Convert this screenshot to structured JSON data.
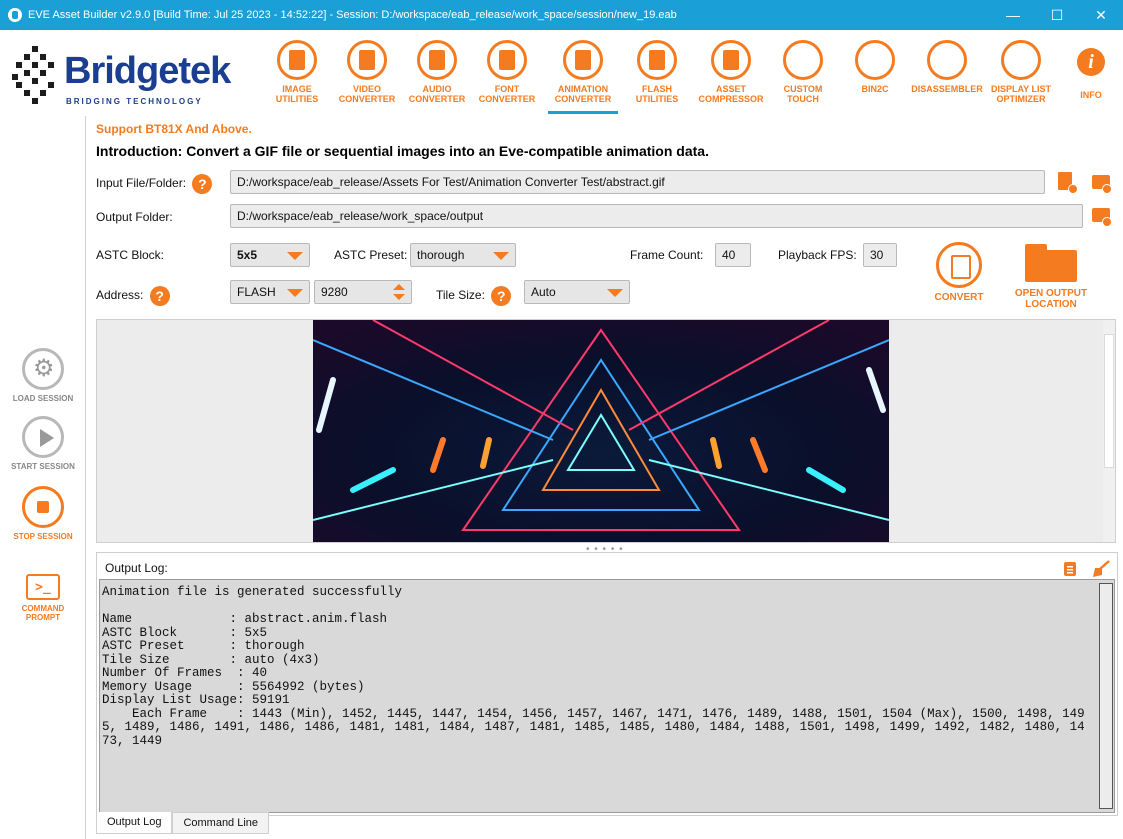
{
  "window": {
    "title": "EVE Asset Builder v2.9.0 [Build Time: Jul 25 2023 - 14:52:22] - Session: D:/workspace/eab_release/work_space/session/new_19.eab",
    "minimize": "—",
    "maximize": "☐",
    "close": "✕"
  },
  "logo": {
    "word": "Bridgetek",
    "tagline": "BRIDGING  TECHNOLOGY"
  },
  "toolbar": [
    {
      "label": "IMAGE\nUTILITIES",
      "icon": "image-icon"
    },
    {
      "label": "VIDEO\nCONVERTER",
      "icon": "video-icon"
    },
    {
      "label": "AUDIO\nCONVERTER",
      "icon": "audio-icon"
    },
    {
      "label": "FONT\nCONVERTER",
      "icon": "font-icon"
    },
    {
      "label": "ANIMATION\nCONVERTER",
      "icon": "animation-icon",
      "active": true
    },
    {
      "label": "FLASH\nUTILITIES",
      "icon": "flash-icon"
    },
    {
      "label": "ASSET\nCOMPRESSOR",
      "icon": "compressor-icon"
    },
    {
      "label": "CUSTOM\nTOUCH",
      "icon": "touch-icon"
    },
    {
      "label": "BIN2C",
      "icon": "binary-icon"
    },
    {
      "label": "DISASSEMBLER",
      "icon": "disassembler-icon"
    },
    {
      "label": "DISPLAY LIST\nOPTIMIZER",
      "icon": "display-list-icon"
    },
    {
      "label": "INFO",
      "icon": "info-icon"
    }
  ],
  "sidebar": {
    "load": "LOAD SESSION",
    "start": "START SESSION",
    "stop": "STOP SESSION",
    "cmd": "COMMAND\nPROMPT",
    "cmd_glyph": ">_"
  },
  "header": {
    "support": "Support BT81X And Above.",
    "intro": "Introduction: Convert a GIF file or sequential images into an Eve-compatible animation data."
  },
  "form": {
    "input_label": "Input File/Folder:",
    "input_value": "D:/workspace/eab_release/Assets For Test/Animation Converter Test/abstract.gif",
    "output_label": "Output Folder:",
    "output_value": "D:/workspace/eab_release/work_space/output",
    "astc_block_label": "ASTC Block:",
    "astc_block_value": "5x5",
    "astc_preset_label": "ASTC Preset:",
    "astc_preset_value": "thorough",
    "frame_count_label": "Frame Count:",
    "frame_count_value": "40",
    "playback_fps_label": "Playback FPS:",
    "playback_fps_value": "30",
    "address_label": "Address:",
    "address_type": "FLASH",
    "address_value": "9280",
    "tile_size_label": "Tile Size:",
    "tile_size_value": "Auto",
    "help": "?"
  },
  "actions": {
    "convert": "CONVERT",
    "open_output": "OPEN OUTPUT\nLOCATION"
  },
  "log": {
    "title": "Output Log:",
    "text": "Animation file is generated successfully\n\nName             : abstract.anim.flash\nASTC Block       : 5x5\nASTC Preset      : thorough\nTile Size        : auto (4x3)\nNumber Of Frames  : 40\nMemory Usage      : 5564992 (bytes)\nDisplay List Usage: 59191\n    Each Frame    : 1443 (Min), 1452, 1445, 1447, 1454, 1456, 1457, 1467, 1471, 1476, 1489, 1488, 1501, 1504 (Max), 1500, 1498, 1495, 1489, 1486, 1491, 1486, 1486, 1481, 1481, 1484, 1487, 1481, 1485, 1485, 1480, 1484, 1488, 1501, 1498, 1499, 1492, 1482, 1480, 1473, 1449"
  },
  "tabs": [
    "Output Log",
    "Command Line"
  ]
}
